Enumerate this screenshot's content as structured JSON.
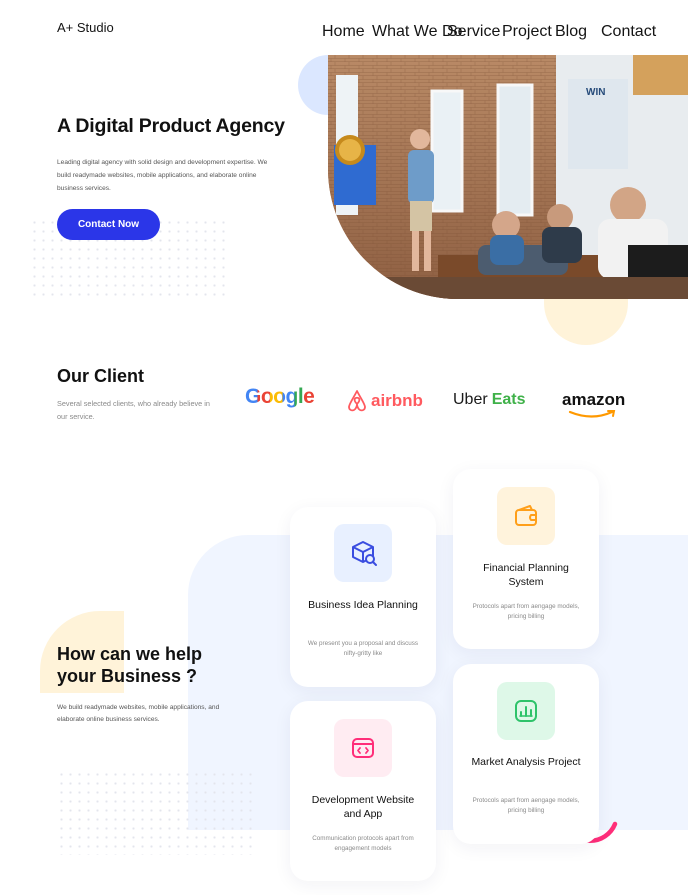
{
  "brand": {
    "name": "A+ Studio"
  },
  "nav": {
    "items": [
      "Home",
      "What We Do",
      "Service",
      "Project",
      "Blog",
      "Contact"
    ]
  },
  "hero": {
    "title": "A Digital Product Agency",
    "description": "Leading digital agency with solid design and development expertise. We build readymade websites, mobile applications, and elaborate online business services.",
    "cta": "Contact Now"
  },
  "clients": {
    "title": "Our Client",
    "description": "Several selected clients, who already believe in our service.",
    "logos": [
      "Google",
      "airbnb",
      "Uber",
      "Eats",
      "amazon"
    ]
  },
  "services": {
    "title_line1": "How can we help",
    "title_line2": "your Business ?",
    "description": "We build readymade websites, mobile applications, and elaborate online business services.",
    "cards": [
      {
        "title": "Business Idea Planning",
        "desc": "We present you a proposal and discuss nifty-gritty like"
      },
      {
        "title": "Financial Planning System",
        "desc": "Protocols apart from aengage models, pricing billing"
      },
      {
        "title": "Development Website and App",
        "desc": "Communication protocols apart from engagement models"
      },
      {
        "title": "Market Analysis Project",
        "desc": "Protocols apart from aengage models, pricing billing"
      }
    ]
  },
  "colors": {
    "accent": "#2b36e8",
    "pink": "#ff2e79",
    "green": "#2ec36a",
    "orange": "#ff9f1a"
  }
}
